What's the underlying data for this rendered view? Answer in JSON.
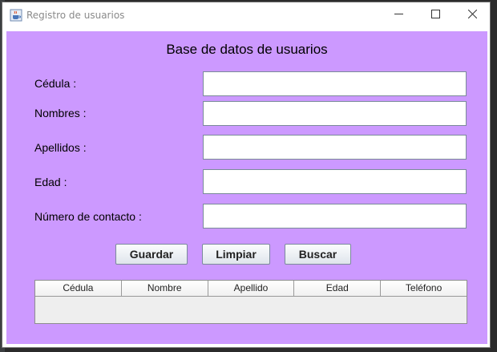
{
  "window": {
    "title": "Registro de usuarios",
    "controls": [
      "minimize-icon",
      "maximize-icon",
      "close-icon"
    ]
  },
  "form": {
    "heading": "Base de datos de usuarios",
    "fields": [
      {
        "label": "Cédula :",
        "value": ""
      },
      {
        "label": "Nombres :",
        "value": ""
      },
      {
        "label": "Apellidos :",
        "value": ""
      },
      {
        "label": "Edad :",
        "value": ""
      },
      {
        "label": "Número de contacto :",
        "value": ""
      }
    ],
    "buttons": {
      "save": "Guardar",
      "clear": "Limpiar",
      "search": "Buscar"
    }
  },
  "table": {
    "columns": [
      "Cédula",
      "Nombre",
      "Apellido",
      "Edad",
      "Teléfono"
    ],
    "rows": []
  },
  "colors": {
    "panel_background": "#cc99ff",
    "titlebar": "#ffffff"
  }
}
